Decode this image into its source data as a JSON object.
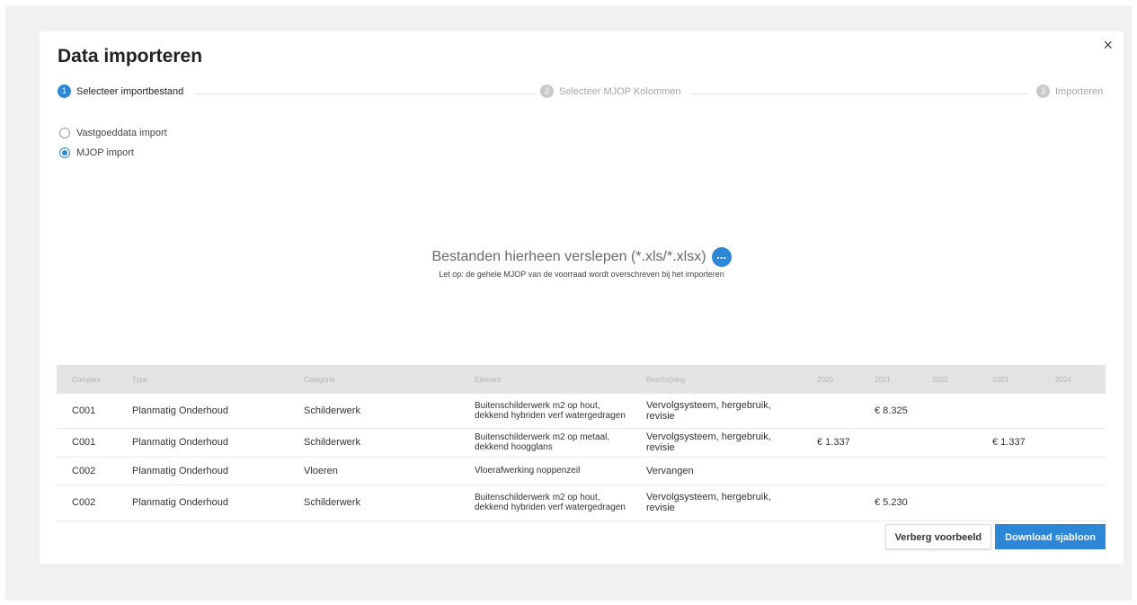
{
  "dialog": {
    "title": "Data importeren",
    "close_label": "×"
  },
  "stepper": {
    "steps": [
      {
        "num": "1",
        "label": "Selecteer importbestand"
      },
      {
        "num": "2",
        "label": "Selecteer MJOP Kolommen"
      },
      {
        "num": "3",
        "label": "Importeren"
      }
    ]
  },
  "import_type": {
    "options": [
      {
        "label": "Vastgoeddata import"
      },
      {
        "label": "MJOP import"
      }
    ]
  },
  "dropzone": {
    "main_text": "Bestanden hierheen verslepen (*.xls/*.xlsx)",
    "browse_label": "...",
    "note": "Let op: de gehele MJOP van de voorraad wordt overschreven bij het importeren"
  },
  "preview_table": {
    "headers": [
      "Complex",
      "Type",
      "Categorie",
      "Element",
      "Beschrijving",
      "2020",
      "2021",
      "2022",
      "2023",
      "2024"
    ],
    "rows": [
      {
        "complex": "C001",
        "type": "Planmatig Onderhoud",
        "categorie": "Schilderwerk",
        "element": "Buitenschilderwerk m2 op hout, dekkend hybriden verf watergedragen",
        "beschrijving": "Vervolgsysteem, hergebruik, revisie",
        "y2020": "",
        "y2021": "€ 8.325",
        "y2022": "",
        "y2023": "",
        "y2024": ""
      },
      {
        "complex": "C001",
        "type": "Planmatig Onderhoud",
        "categorie": "Schilderwerk",
        "element": "Buitenschilderwerk m2 op metaal, dekkend hoogglans",
        "beschrijving": "Vervolgsysteem, hergebruik, revisie",
        "y2020": "€ 1.337",
        "y2021": "",
        "y2022": "",
        "y2023": "€ 1.337",
        "y2024": ""
      },
      {
        "complex": "C002",
        "type": "Planmatig Onderhoud",
        "categorie": "Vloeren",
        "element": "Vloerafwerking noppenzeil",
        "beschrijving": "Vervangen",
        "y2020": "",
        "y2021": "",
        "y2022": "",
        "y2023": "",
        "y2024": ""
      },
      {
        "complex": "C002",
        "type": "Planmatig Onderhoud",
        "categorie": "Schilderwerk",
        "element": "Buitenschilderwerk m2 op hout, dekkend hybriden verf watergedragen",
        "beschrijving": "Vervolgsysteem, hergebruik, revisie",
        "y2020": "",
        "y2021": "€ 5.230",
        "y2022": "",
        "y2023": "",
        "y2024": ""
      }
    ]
  },
  "footer": {
    "hide_preview_label": "Verberg voorbeeld",
    "download_label": "Download sjabloon"
  },
  "colors": {
    "accent": "#2d86d6",
    "inactive_step": "#c9c9c9",
    "table_header_bg": "#e3e3e3"
  }
}
